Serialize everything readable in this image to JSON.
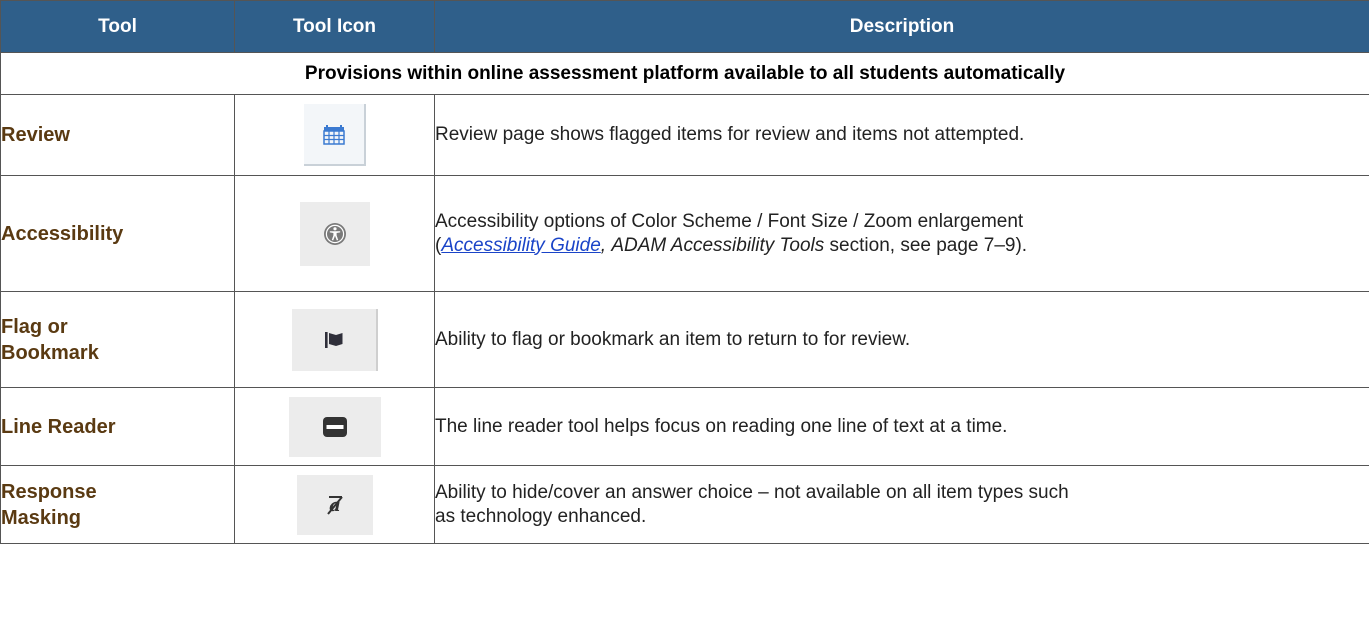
{
  "header": {
    "tool": "Tool",
    "tool_icon": "Tool Icon",
    "description": "Description"
  },
  "section_title": "Provisions within online assessment platform available to all students automatically",
  "rows": [
    {
      "name": "Review",
      "icon": "calendar-grid-icon",
      "description": "Review page shows flagged items for review and items not attempted."
    },
    {
      "name": "Accessibility",
      "icon": "accessibility-person-icon",
      "description_line1": "Accessibility options of Color Scheme / Font Size / Zoom enlargement",
      "description_line2": {
        "open_paren": "(",
        "link": "Accessibility Guide",
        "comma": ",",
        "italic": "ADAM Accessibility Tools",
        "rest": " section, see page 7–9)."
      }
    },
    {
      "name_line1": "Flag or",
      "name_line2": "Bookmark",
      "icon": "flag-icon",
      "description": "Ability to flag or bookmark an item to return to for review."
    },
    {
      "name": "Line Reader",
      "icon": "line-reader-icon",
      "description": "The line reader tool helps focus on reading one line of text at a time."
    },
    {
      "name_line1": "Response",
      "name_line2": "Masking",
      "icon": "strikethrough-a-icon",
      "description_line1": "Ability to hide/cover an answer choice – not available on all item types such",
      "description_line2": "as technology enhanced."
    }
  ],
  "colors": {
    "header_bg": "#2f5f8a",
    "tool_name": "#5a3a12",
    "link": "#1a44c8",
    "review_icon": "#3b7ad1"
  }
}
